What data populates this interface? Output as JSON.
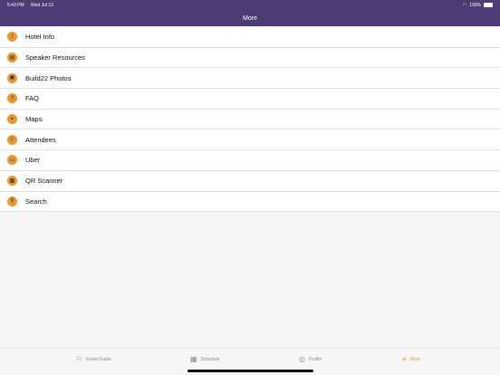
{
  "status_bar": {
    "time": "5:43 PM",
    "date": "Wed Jul 13",
    "battery": "100%"
  },
  "nav": {
    "title": "More"
  },
  "menu": {
    "items": [
      {
        "label": "Hotel Info",
        "icon": "info-icon",
        "glyph": "!"
      },
      {
        "label": "Speaker Resources",
        "icon": "speaker-resources-icon",
        "glyph": "▤"
      },
      {
        "label": "Build22 Photos",
        "icon": "photos-icon",
        "glyph": "▣"
      },
      {
        "label": "FAQ",
        "icon": "faq-icon",
        "glyph": "?"
      },
      {
        "label": "Maps",
        "icon": "map-icon",
        "glyph": "⌖"
      },
      {
        "label": "Attendees",
        "icon": "attendees-icon",
        "glyph": "☺"
      },
      {
        "label": "Uber",
        "icon": "car-icon",
        "glyph": "▭"
      },
      {
        "label": "QR Scanner",
        "icon": "qr-icon",
        "glyph": "▦"
      },
      {
        "label": "Search",
        "icon": "search-icon",
        "glyph": "⚲"
      }
    ]
  },
  "tabs": [
    {
      "label": "Event Guide",
      "icon": "event-guide-icon",
      "glyph": "⚐",
      "active": false
    },
    {
      "label": "Schedule",
      "icon": "calendar-icon",
      "glyph": "▦",
      "active": false
    },
    {
      "label": "Profile",
      "icon": "profile-icon",
      "glyph": "◎",
      "active": false
    },
    {
      "label": "More",
      "icon": "menu-icon",
      "glyph": "≡",
      "active": true
    }
  ],
  "colors": {
    "header": "#4d3b75",
    "accent": "#e8972e"
  }
}
